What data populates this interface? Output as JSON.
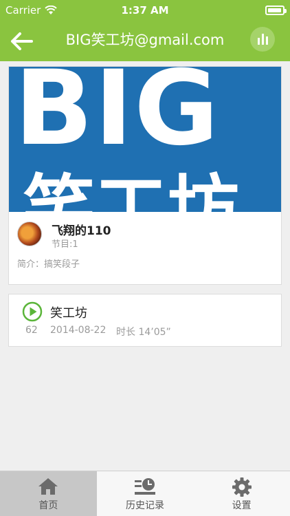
{
  "status": {
    "carrier": "Carrier",
    "time": "1:37 AM"
  },
  "header": {
    "title": "BIG笑工坊@gmail.com"
  },
  "album": {
    "cover_line1": "BIG",
    "cover_line2": "笑工坊",
    "anchor_name": "飞翔的110",
    "program_count": "节目:1",
    "intro": "简介：搞笑段子"
  },
  "episode": {
    "title": "笑工坊",
    "plays": "62",
    "date": "2014-08-22",
    "duration": "时长 14’05”"
  },
  "tabs": [
    {
      "label": "首页",
      "icon": "home-icon",
      "active": true
    },
    {
      "label": "历史记录",
      "icon": "history-icon",
      "active": false
    },
    {
      "label": "设置",
      "icon": "gear-icon",
      "active": false
    }
  ],
  "colors": {
    "accent": "#8ac43f",
    "play": "#5bb53a",
    "cover_bg": "#1f70b2"
  }
}
